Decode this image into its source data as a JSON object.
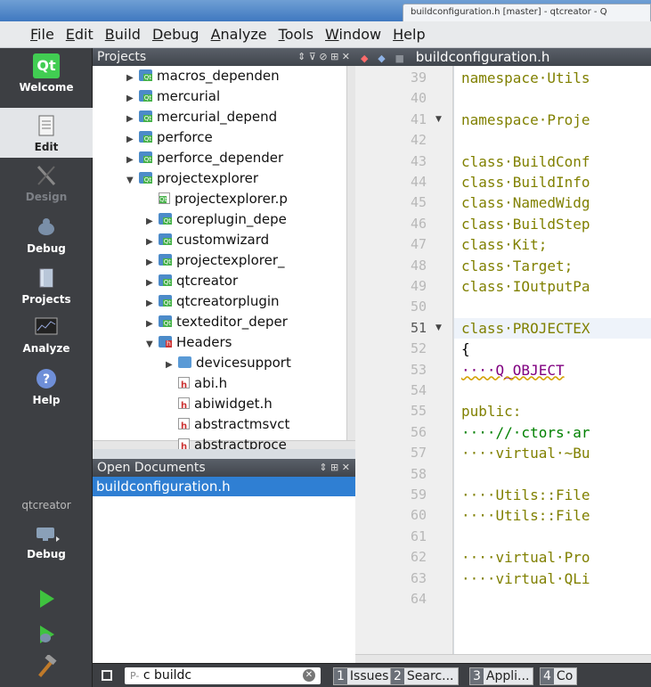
{
  "window": {
    "title": "buildconfiguration.h [master] - qtcreator - Q"
  },
  "menubar": {
    "items": [
      {
        "label": "File",
        "accel": "F",
        "rest": "ile"
      },
      {
        "label": "Edit",
        "accel": "E",
        "rest": "dit"
      },
      {
        "label": "Build",
        "accel": "B",
        "rest": "uild"
      },
      {
        "label": "Debug",
        "accel": "D",
        "rest": "ebug"
      },
      {
        "label": "Analyze",
        "accel": "A",
        "rest": "nalyze"
      },
      {
        "label": "Tools",
        "accel": "T",
        "rest": "ools"
      },
      {
        "label": "Window",
        "accel": "W",
        "rest": "indow"
      },
      {
        "label": "Help",
        "accel": "H",
        "rest": "elp"
      }
    ]
  },
  "modes": [
    {
      "label": "Welcome",
      "icon": "qt-logo-icon"
    },
    {
      "label": "Edit",
      "icon": "edit-document-icon"
    },
    {
      "label": "Design",
      "icon": "design-pen-icon"
    },
    {
      "label": "Debug",
      "icon": "debug-bug-icon"
    },
    {
      "label": "Projects",
      "icon": "projects-icon"
    },
    {
      "label": "Analyze",
      "icon": "analyze-monitor-icon"
    },
    {
      "label": "Help",
      "icon": "help-icon"
    }
  ],
  "kit": {
    "project": "qtcreator",
    "config": "Debug"
  },
  "projects_panel": {
    "title": "Projects",
    "tree": [
      {
        "label": "macros_dependen",
        "type": "folder-qt",
        "arrow": "▶",
        "indent": 1
      },
      {
        "label": "mercurial",
        "type": "folder-qt",
        "arrow": "▶",
        "indent": 1
      },
      {
        "label": "mercurial_depend",
        "type": "folder-qt",
        "arrow": "▶",
        "indent": 1
      },
      {
        "label": "perforce",
        "type": "folder-qt",
        "arrow": "▶",
        "indent": 1
      },
      {
        "label": "perforce_depender",
        "type": "folder-qt",
        "arrow": "▶",
        "indent": 1
      },
      {
        "label": "projectexplorer",
        "type": "folder-qt",
        "arrow": "▼",
        "indent": 1
      },
      {
        "label": "projectexplorer.p",
        "type": "file-pro",
        "arrow": "",
        "indent": 2
      },
      {
        "label": "coreplugin_depe",
        "type": "folder-qt",
        "arrow": "▶",
        "indent": 2
      },
      {
        "label": "customwizard",
        "type": "folder-qt",
        "arrow": "▶",
        "indent": 2
      },
      {
        "label": "projectexplorer_",
        "type": "folder-qt",
        "arrow": "▶",
        "indent": 2
      },
      {
        "label": "qtcreator",
        "type": "folder-qt",
        "arrow": "▶",
        "indent": 2
      },
      {
        "label": "qtcreatorplugin",
        "type": "folder-qt",
        "arrow": "▶",
        "indent": 2
      },
      {
        "label": "texteditor_deper",
        "type": "folder-qt",
        "arrow": "▶",
        "indent": 2
      },
      {
        "label": "Headers",
        "type": "folder-h",
        "arrow": "▼",
        "indent": 2
      },
      {
        "label": "devicesupport",
        "type": "folder-plain",
        "arrow": "▶",
        "indent": 3
      },
      {
        "label": "abi.h",
        "type": "file-h",
        "arrow": "",
        "indent": 3
      },
      {
        "label": "abiwidget.h",
        "type": "file-h",
        "arrow": "",
        "indent": 3
      },
      {
        "label": "abstractmsvct",
        "type": "file-h",
        "arrow": "",
        "indent": 3
      },
      {
        "label": "abstractproce",
        "type": "file-h",
        "arrow": "",
        "indent": 3
      }
    ]
  },
  "open_documents": {
    "title": "Open Documents",
    "items": [
      "buildconfiguration.h"
    ]
  },
  "editor": {
    "filename": "buildconfiguration.h",
    "current_line": 51,
    "lines": [
      {
        "n": 39,
        "text": "namespace·Utils",
        "kind": "kw",
        "fold": ""
      },
      {
        "n": 40,
        "text": "",
        "kind": "plain",
        "fold": ""
      },
      {
        "n": 41,
        "text": "namespace·Proje",
        "kind": "kw",
        "fold": "▼"
      },
      {
        "n": 42,
        "text": "",
        "kind": "plain",
        "fold": ""
      },
      {
        "n": 43,
        "text": "class·BuildConf",
        "kind": "kw",
        "fold": ""
      },
      {
        "n": 44,
        "text": "class·BuildInfo",
        "kind": "kw",
        "fold": ""
      },
      {
        "n": 45,
        "text": "class·NamedWidg",
        "kind": "kw",
        "fold": ""
      },
      {
        "n": 46,
        "text": "class·BuildStep",
        "kind": "kw",
        "fold": ""
      },
      {
        "n": 47,
        "text": "class·Kit;",
        "kind": "kw",
        "fold": ""
      },
      {
        "n": 48,
        "text": "class·Target;",
        "kind": "kw",
        "fold": ""
      },
      {
        "n": 49,
        "text": "class·IOutputPa",
        "kind": "kw",
        "fold": ""
      },
      {
        "n": 50,
        "text": "",
        "kind": "plain",
        "fold": ""
      },
      {
        "n": 51,
        "text": "class·PROJECTEX",
        "kind": "kw",
        "fold": "▼"
      },
      {
        "n": 52,
        "text": "{",
        "kind": "plain",
        "fold": ""
      },
      {
        "n": 53,
        "text": "····Q_OBJECT",
        "kind": "macro",
        "fold": ""
      },
      {
        "n": 54,
        "text": "",
        "kind": "plain",
        "fold": ""
      },
      {
        "n": 55,
        "text": "public:",
        "kind": "kw",
        "fold": ""
      },
      {
        "n": 56,
        "text": "····//·ctors·ar",
        "kind": "comment",
        "fold": ""
      },
      {
        "n": 57,
        "text": "····virtual·~Bu",
        "kind": "kw",
        "fold": ""
      },
      {
        "n": 58,
        "text": "",
        "kind": "plain",
        "fold": ""
      },
      {
        "n": 59,
        "text": "····Utils::File",
        "kind": "kw",
        "fold": ""
      },
      {
        "n": 60,
        "text": "····Utils::File",
        "kind": "kw",
        "fold": ""
      },
      {
        "n": 61,
        "text": "",
        "kind": "plain",
        "fold": ""
      },
      {
        "n": 62,
        "text": "····virtual·Pro",
        "kind": "kw",
        "fold": ""
      },
      {
        "n": 63,
        "text": "····virtual·QLi",
        "kind": "kw",
        "fold": ""
      },
      {
        "n": 64,
        "text": "",
        "kind": "plain",
        "fold": ""
      }
    ]
  },
  "bottombar": {
    "search_value": "c buildc",
    "search_prefix": "P-",
    "tabs": [
      {
        "num": "1",
        "label": "Issues"
      },
      {
        "num": "2",
        "label": "Searc..."
      },
      {
        "num": "3",
        "label": "Appli..."
      },
      {
        "num": "4",
        "label": "Co"
      }
    ]
  },
  "colors": {
    "selection": "#2f7fd3",
    "keyword": "#808000",
    "comment": "#008000",
    "macro": "#800080",
    "modebar": "#3d3f43"
  }
}
